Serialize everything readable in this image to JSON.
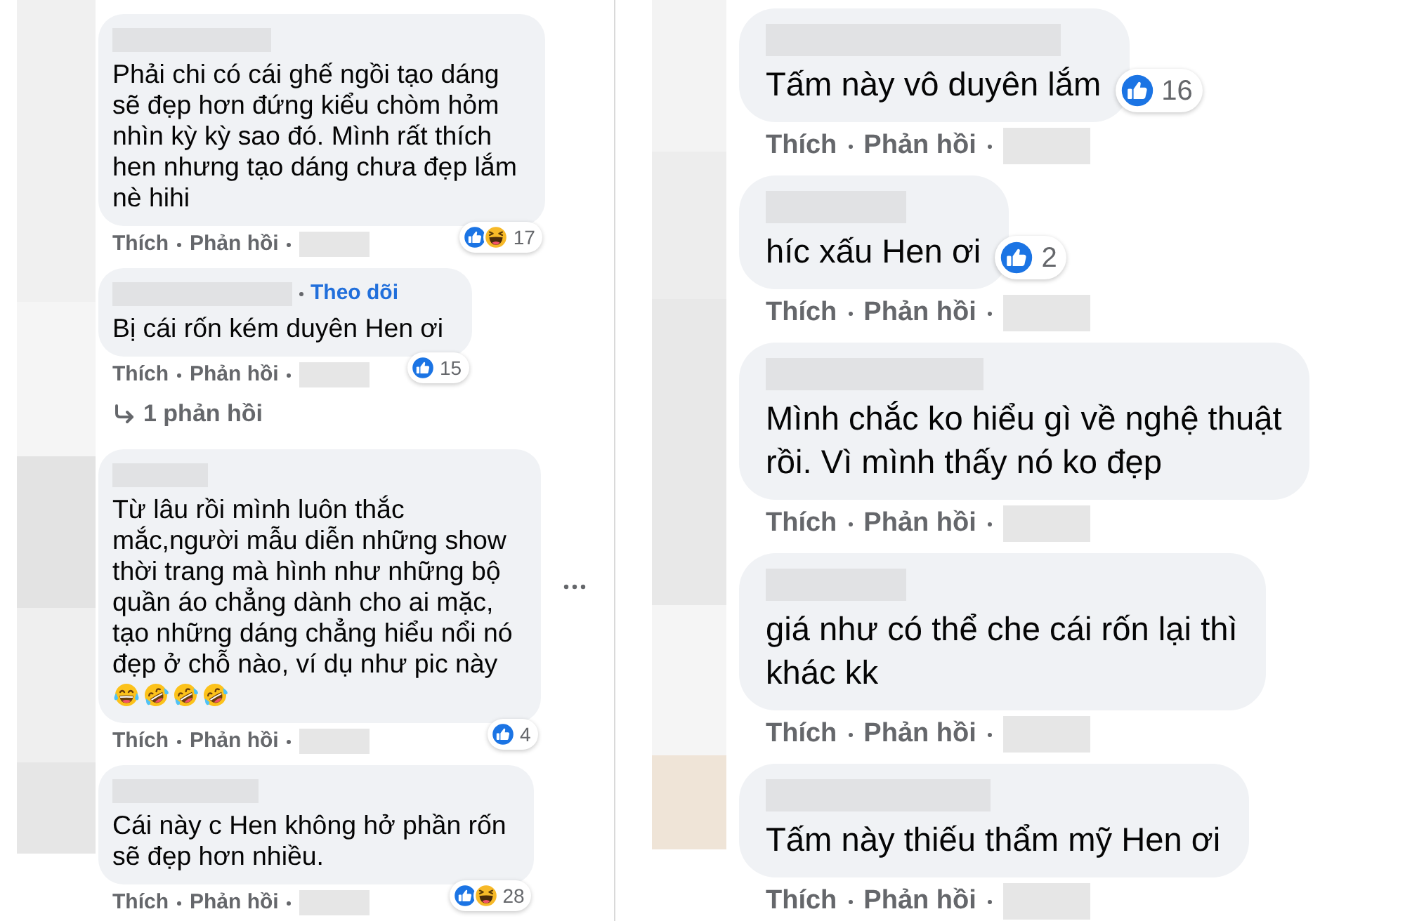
{
  "panels": [
    {
      "comments": [
        {
          "lines": [
            "Phải chi có cái ghế ngồi tạo dáng",
            "sẽ đẹp hơn đứng kiểu chòm hỏm",
            "nhìn kỳ kỳ sao đó. Mình rất thích",
            "hen nhưng tạo dáng chưa đẹp lắm",
            "nè hihi"
          ],
          "reactions": [
            {
              "kind": "like"
            },
            {
              "kind": "haha"
            }
          ],
          "reaction_count": "17",
          "actions": [
            "Thích",
            "Phản hồi"
          ],
          "options_menu": false
        },
        {
          "follow": "Theo dõi",
          "lines": [
            "Bị cái rốn kém duyên Hen ơi"
          ],
          "reactions": [
            {
              "kind": "like"
            }
          ],
          "reaction_count": "15",
          "actions": [
            "Thích",
            "Phản hồi"
          ],
          "replies_link": "1 phản hồi",
          "options_menu": false
        },
        {
          "lines": [
            "Từ lâu rồi mình luôn thắc",
            "mắc,người mẫu diễn những show",
            "thời trang mà hình như những bộ",
            "quần áo chẳng dành cho ai mặc,",
            "tạo những dáng chẳng hiểu nổi nó",
            "đẹp ở chỗ nào, ví dụ như pic này"
          ],
          "emojis": [
            {
              "kind": "tears_of_joy"
            },
            {
              "kind": "rolling_laughing"
            },
            {
              "kind": "rolling_laughing"
            },
            {
              "kind": "rolling_laughing"
            }
          ],
          "reactions": [
            {
              "kind": "like"
            }
          ],
          "reaction_count": "4",
          "actions": [
            "Thích",
            "Phản hồi"
          ],
          "options_menu": true
        },
        {
          "lines": [
            "Cái này c Hen không hở phần rốn",
            "sẽ đẹp hơn nhiều."
          ],
          "reactions": [
            {
              "kind": "like"
            },
            {
              "kind": "haha"
            }
          ],
          "reaction_count": "28",
          "actions": [
            "Thích",
            "Phản hồi"
          ],
          "options_menu": false
        }
      ]
    },
    {
      "comments": [
        {
          "lines": [
            "Tấm này vô duyên lắm"
          ],
          "reactions": [
            {
              "kind": "like"
            }
          ],
          "reaction_count": "16",
          "actions": [
            "Thích",
            "Phản hồi"
          ],
          "options_menu": false
        },
        {
          "lines": [
            "híc xấu Hen ơi"
          ],
          "reactions": [
            {
              "kind": "like"
            }
          ],
          "reaction_count": "2",
          "actions": [
            "Thích",
            "Phản hồi"
          ],
          "options_menu": false
        },
        {
          "lines": [
            "Mình chắc ko hiểu gì về nghệ thuật",
            "rồi. Vì mình thấy nó ko đẹp"
          ],
          "actions": [
            "Thích",
            "Phản hồi"
          ],
          "options_menu": false
        },
        {
          "lines": [
            "giá như có thể che cái rốn lại thì",
            "khác kk"
          ],
          "actions": [
            "Thích",
            "Phản hồi"
          ],
          "options_menu": false
        },
        {
          "lines": [
            "Tấm này thiếu thẩm mỹ Hen ơi"
          ],
          "actions": [
            "Thích",
            "Phản hồi"
          ],
          "options_menu": false
        }
      ]
    }
  ]
}
